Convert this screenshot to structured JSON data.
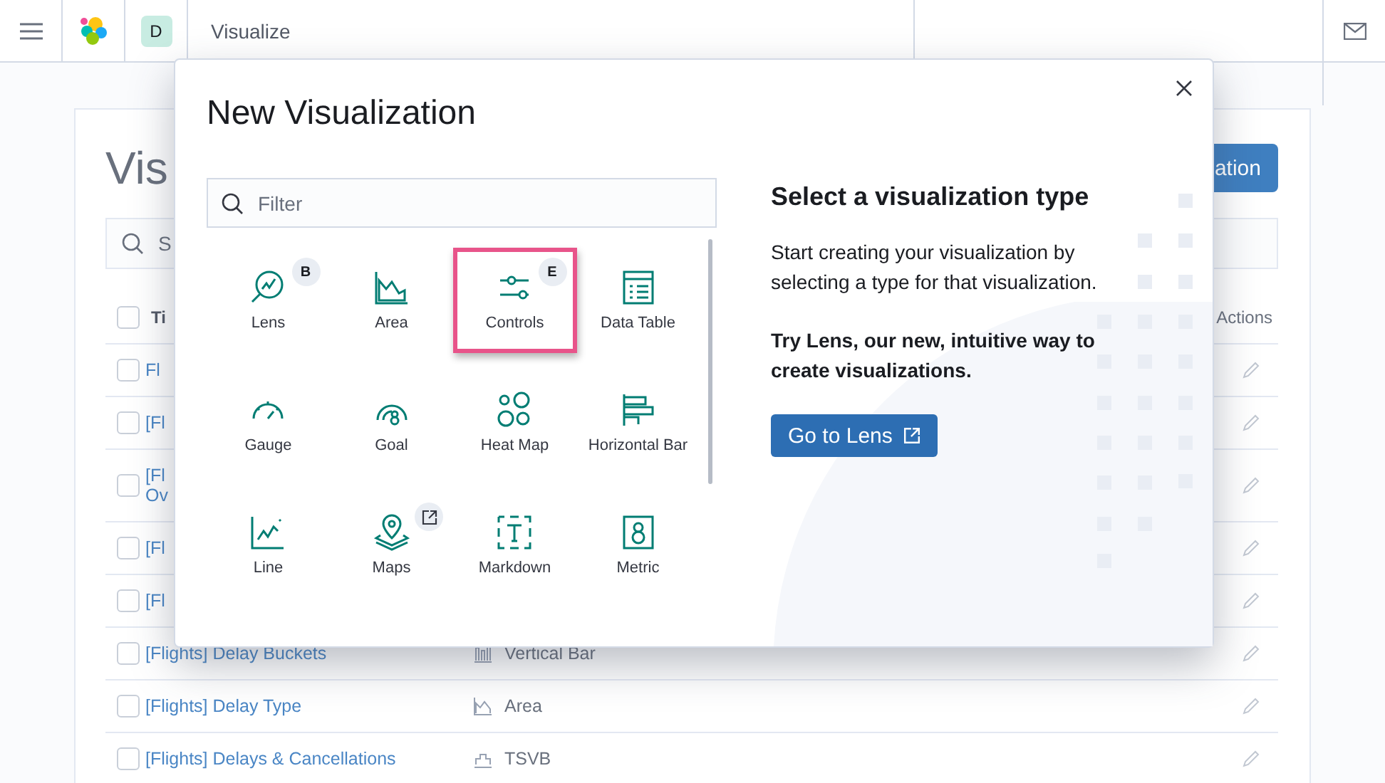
{
  "header": {
    "avatar": "D",
    "breadcrumb": "Visualize"
  },
  "page": {
    "title": "Vis",
    "create_button": "ation",
    "search_placeholder": "S",
    "columns": [
      "Ti",
      "Actions"
    ],
    "all_checked": false,
    "rows": [
      {
        "title": "Fl",
        "checked": false
      },
      {
        "title": "[Fl",
        "checked": false
      },
      {
        "title": "[Fl",
        "title_line_2": "Ov",
        "checked": false
      },
      {
        "title": "[Fl",
        "checked": false
      },
      {
        "title": "[Fl",
        "checked": false
      },
      {
        "title": "[Flights] Delay Buckets",
        "type": "Vertical Bar",
        "kind": "vertical-bar",
        "checked": false
      },
      {
        "title": "[Flights] Delay Type",
        "type": "Area",
        "kind": "area",
        "checked": false
      },
      {
        "title": "[Flights] Delays & Cancellations",
        "type": "TSVB",
        "kind": "tsvb",
        "checked": false
      }
    ]
  },
  "modal": {
    "title": "New Visualization",
    "filter_placeholder": "Filter",
    "types": [
      {
        "label": "Lens",
        "badge": {
          "kind": "letter",
          "text": "B"
        },
        "highlighted": false
      },
      {
        "label": "Area",
        "highlighted": false
      },
      {
        "label": "Controls",
        "badge": {
          "kind": "letter",
          "text": "E"
        },
        "highlighted": true
      },
      {
        "label": "Data Table",
        "highlighted": false
      },
      {
        "label": "Gauge",
        "highlighted": false
      },
      {
        "label": "Goal",
        "highlighted": false
      },
      {
        "label": "Heat Map",
        "highlighted": false
      },
      {
        "label": "Horizontal Bar",
        "highlighted": false
      },
      {
        "label": "Line",
        "highlighted": false
      },
      {
        "label": "Maps",
        "badge": {
          "kind": "external-link"
        },
        "highlighted": false
      },
      {
        "label": "Markdown",
        "highlighted": false
      },
      {
        "label": "Metric",
        "highlighted": false
      }
    ],
    "side": {
      "heading": "Select a visualization type",
      "text": "Start creating your visualization by selecting a type for that visualization.",
      "promo": "Try Lens, our new, intuitive way to create visualizations.",
      "button": "Go to Lens"
    }
  }
}
